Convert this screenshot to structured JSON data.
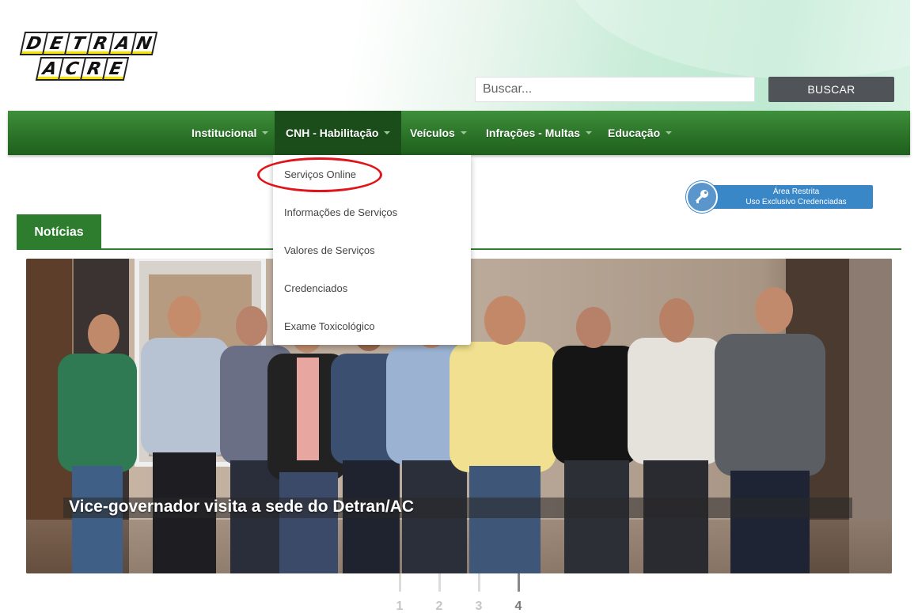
{
  "logo": {
    "row1": [
      "D",
      "E",
      "T",
      "R",
      "A",
      "N"
    ],
    "row2": [
      "A",
      "C",
      "R",
      "E"
    ]
  },
  "search": {
    "placeholder": "Buscar...",
    "button_label": "BUSCAR"
  },
  "nav": {
    "items": [
      {
        "label": "Institucional"
      },
      {
        "label": "CNH - Habilitação"
      },
      {
        "label": "Veículos"
      },
      {
        "label": "Infrações - Multas"
      },
      {
        "label": "Educação"
      }
    ]
  },
  "dropdown": {
    "items": [
      {
        "label": "Serviços Online"
      },
      {
        "label": "Informações de Serviços"
      },
      {
        "label": "Valores de Serviços"
      },
      {
        "label": "Credenciados"
      },
      {
        "label": "Exame Toxicológico"
      }
    ]
  },
  "restricted": {
    "line1": "Área Restrita",
    "line2": "Uso Exclusivo Credenciadas"
  },
  "news": {
    "tab_label": "Notícias",
    "caption": "Vice-governador visita a sede do Detran/AC",
    "pages": [
      "1",
      "2",
      "3",
      "4"
    ],
    "active_page": "4"
  },
  "colors": {
    "nav_green": "#2d762a",
    "accent_red": "#e0151b",
    "restricted_blue": "#3a87c8",
    "search_button": "#505459"
  }
}
